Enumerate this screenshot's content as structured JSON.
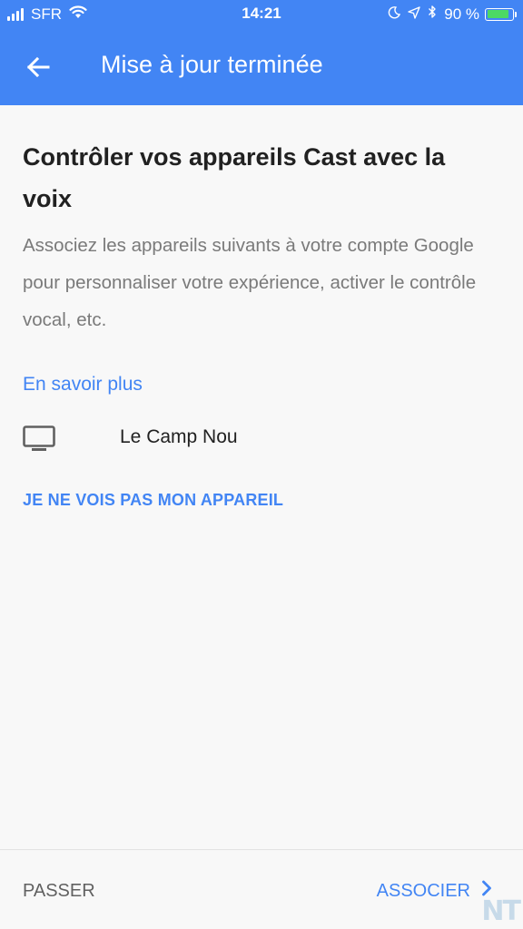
{
  "status_bar": {
    "carrier": "SFR",
    "time": "14:21",
    "battery": "90 %",
    "battery_level": 0.9,
    "icons": [
      "signal-icon",
      "wifi-icon",
      "moon-icon",
      "location-icon",
      "bluetooth-icon",
      "battery-icon"
    ]
  },
  "app_bar": {
    "title": "Mise à jour terminée",
    "back_icon": "arrow-back-icon",
    "color": "#4285f4"
  },
  "content": {
    "heading": "Contrôler vos appareils Cast avec la voix",
    "description": "Associez les appareils suivants à votre compte Google pour personnaliser votre expérience, activer le contrôle vocal, etc.",
    "learn_more": "En savoir plus",
    "device": {
      "icon": "tv-icon",
      "name": "Le Camp Nou"
    },
    "not_seen_label": "JE NE VOIS PAS MON APPAREIL"
  },
  "footer": {
    "skip_label": "PASSER",
    "associate_label": "ASSOCIER",
    "associate_icon": "chevron-right-icon"
  },
  "watermark": "NT",
  "colors": {
    "accent": "#4285f4",
    "background": "#f8f8f8",
    "heading_text": "#212121",
    "secondary_text": "#7a7a7a"
  }
}
